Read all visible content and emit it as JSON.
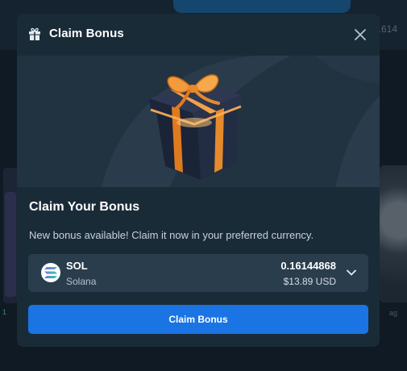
{
  "background": {
    "top_right_number": ".614",
    "bottom_left_text": "1",
    "bottom_right_text": "ag"
  },
  "modal": {
    "title": "Claim Bonus",
    "title_icon": "gift-icon",
    "close_icon": "close-icon",
    "hero_image": "gift-box-illustration",
    "section_title": "Claim Your Bonus",
    "description": "New bonus available! Claim it now in your preferred currency.",
    "currency": {
      "code": "SOL",
      "name": "Solana",
      "amount": "0.16144868",
      "usd_value": "$13.89 USD",
      "icon": "solana-icon",
      "dropdown_icon": "chevron-down-icon"
    },
    "claim_button_label": "Claim Bonus"
  },
  "colors": {
    "modal_bg": "#1a2b38",
    "hero_bg": "#213240",
    "select_bg": "#2a3d4d",
    "accent_blue": "#1a74e4",
    "gift_orange": "#f08a2a"
  }
}
